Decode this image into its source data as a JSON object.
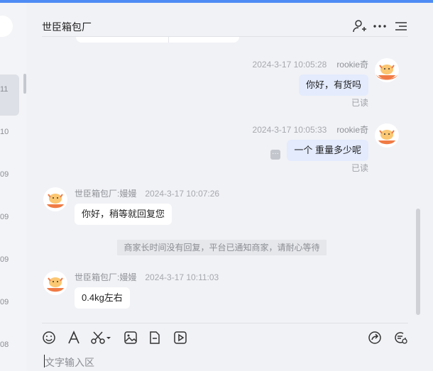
{
  "sidebar": {
    "dates": [
      "11",
      "10",
      "09",
      "09",
      "09",
      "09",
      "08"
    ]
  },
  "chat": {
    "title": "世臣箱包厂",
    "messages": [
      {
        "timestamp": "2024-3-17 10:05:28",
        "sender": "rookie奇",
        "text": "你好，有货吗",
        "status": "已读"
      },
      {
        "timestamp": "2024-3-17 10:05:33",
        "sender": "rookie奇",
        "text": "一个 重量多少呢",
        "status": "已读"
      },
      {
        "timestamp": "2024-3-17 10:07:26",
        "sender": "世臣箱包厂:嫚嫚",
        "text": "你好，稍等就回复您"
      },
      {
        "timestamp": "2024-3-17 10:11:03",
        "sender": "世臣箱包厂:嫚嫚",
        "text": "0.4kg左右"
      }
    ],
    "system_notice": "商家长时间没有回复，平台已通知商家，请耐心等待"
  },
  "input": {
    "placeholder": "文字输入区"
  },
  "colors": {
    "accent": "#4f8bf5",
    "my_bubble": "#e3ebfd",
    "their_bubble": "#ffffff",
    "avatar_orange": "#f07b45"
  },
  "icons": {
    "header": [
      "add-user-icon",
      "more-icon",
      "menu-icon"
    ],
    "toolbar": [
      "emoji-icon",
      "font-icon",
      "scissors-icon",
      "image-icon",
      "file-icon",
      "video-icon",
      "share-icon",
      "quick-reply-icon"
    ]
  }
}
